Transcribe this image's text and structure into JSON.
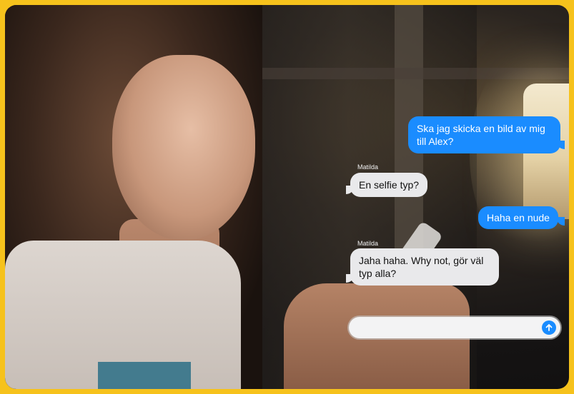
{
  "messages": [
    {
      "direction": "outgoing",
      "sender": "",
      "text": "Ska jag skicka en bild av mig till Alex?"
    },
    {
      "direction": "incoming",
      "sender": "Matilda",
      "text": "En selfie typ?"
    },
    {
      "direction": "outgoing",
      "sender": "",
      "text": "Haha en nude"
    },
    {
      "direction": "incoming",
      "sender": "Matilda",
      "text": "Jaha haha. Why not, gör väl typ alla?"
    }
  ],
  "composer": {
    "placeholder": "",
    "send_icon": "arrow-up-icon"
  },
  "colors": {
    "outgoing_bubble": "#1a8cff",
    "incoming_bubble": "#e9e9eb",
    "border": "#f6c21c"
  }
}
